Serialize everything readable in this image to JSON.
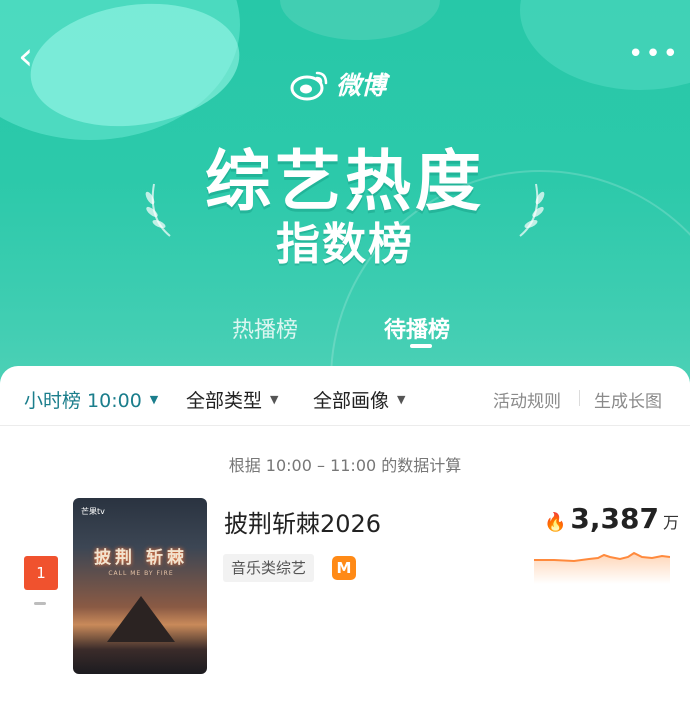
{
  "nav": {
    "back_icon": "chevron-left-icon",
    "more_icon": "more-dots-icon"
  },
  "brand": {
    "name": "微博",
    "logo_icon": "weibo-logo-icon"
  },
  "header": {
    "title": "综艺热度",
    "subtitle": "指数榜"
  },
  "tabs": [
    {
      "label": "热播榜",
      "active": false
    },
    {
      "label": "待播榜",
      "active": true
    }
  ],
  "filters": [
    {
      "label": "小时榜 10:00",
      "selected": true
    },
    {
      "label": "全部类型",
      "selected": false
    },
    {
      "label": "全部画像",
      "selected": false
    }
  ],
  "links": {
    "rules": "活动规则",
    "long_image": "生成长图"
  },
  "calc_note": "根据 10:00 – 11:00 的数据计算",
  "items": [
    {
      "rank": "1",
      "title": "披荆斩棘2026",
      "genre": "音乐类综艺",
      "platform_icon": "mango-tv-icon",
      "platform_glyph": "M",
      "heat_value": "3,387",
      "heat_unit": "万",
      "heat_icon": "flame-icon",
      "poster": {
        "brand": "芒果tv",
        "logo": "披荆 斩棘",
        "sub": "CALL ME BY FIRE"
      }
    }
  ],
  "colors": {
    "hero": "#2cc9aa",
    "accent_filter": "#1b7e8c",
    "rank_badge": "#f0522e",
    "heat": "#ff6a2a",
    "platform": "#ff8a16"
  }
}
